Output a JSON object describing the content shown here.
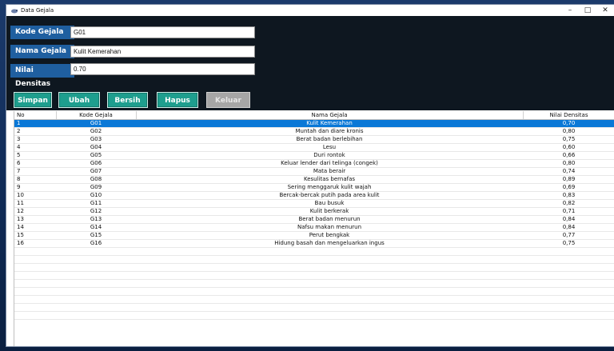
{
  "window": {
    "title": "Data Gejala",
    "controls": {
      "minimize": "–",
      "maximize": "□",
      "close": "✕"
    }
  },
  "form": {
    "kode_label": "Kode Gejala",
    "kode_value": "G01",
    "nama_label": "Nama Gejala",
    "nama_value": "Kulit Kemerahan",
    "nilai_label": "Nilai Densitas",
    "nilai_value": "0.70"
  },
  "buttons": {
    "simpan": "Simpan",
    "ubah": "Ubah",
    "bersih": "Bersih",
    "hapus": "Hapus",
    "keluar": "Keluar"
  },
  "table": {
    "headers": {
      "no": "No",
      "kode": "Kode Gejala",
      "nama": "Nama Gejala",
      "nilai": "Nilai Densitas"
    },
    "rows": [
      {
        "no": "1",
        "kode": "G01",
        "nama": "Kulit Kemerahan",
        "nilai": "0,70"
      },
      {
        "no": "2",
        "kode": "G02",
        "nama": "Muntah dan diare kronis",
        "nilai": "0,80"
      },
      {
        "no": "3",
        "kode": "G03",
        "nama": "Berat badan berlebihan",
        "nilai": "0,75"
      },
      {
        "no": "4",
        "kode": "G04",
        "nama": "Lesu",
        "nilai": "0,60"
      },
      {
        "no": "5",
        "kode": "G05",
        "nama": "Duri rontok",
        "nilai": "0,66"
      },
      {
        "no": "6",
        "kode": "G06",
        "nama": "Keluar lender dari telinga (congek)",
        "nilai": "0,80"
      },
      {
        "no": "7",
        "kode": "G07",
        "nama": "Mata berair",
        "nilai": "0,74"
      },
      {
        "no": "8",
        "kode": "G08",
        "nama": "Kesulitas bernafas",
        "nilai": "0,89"
      },
      {
        "no": "9",
        "kode": "G09",
        "nama": "Sering menggaruk kulit wajah",
        "nilai": "0,69"
      },
      {
        "no": "10",
        "kode": "G10",
        "nama": "Bercak-bercak putih pada area kulit",
        "nilai": "0,83"
      },
      {
        "no": "11",
        "kode": "G11",
        "nama": "Bau busuk",
        "nilai": "0,82"
      },
      {
        "no": "12",
        "kode": "G12",
        "nama": "Kulit berkerak",
        "nilai": "0,71"
      },
      {
        "no": "13",
        "kode": "G13",
        "nama": "Berat badan menurun",
        "nilai": "0,84"
      },
      {
        "no": "14",
        "kode": "G14",
        "nama": "Nafsu makan menurun",
        "nilai": "0,84"
      },
      {
        "no": "15",
        "kode": "G15",
        "nama": "Perut bengkak",
        "nilai": "0,77"
      },
      {
        "no": "16",
        "kode": "G16",
        "nama": "Hidung basah dan mengeluarkan ingus",
        "nilai": "0,75"
      }
    ],
    "selected_index": 0
  },
  "icons": {
    "app": "hedgehog-app-icon"
  },
  "colors": {
    "label_bg": "#1f5fa0",
    "button_bg": "#1e9e8e",
    "selection": "#0a78d7",
    "form_bg": "#0e1720"
  }
}
